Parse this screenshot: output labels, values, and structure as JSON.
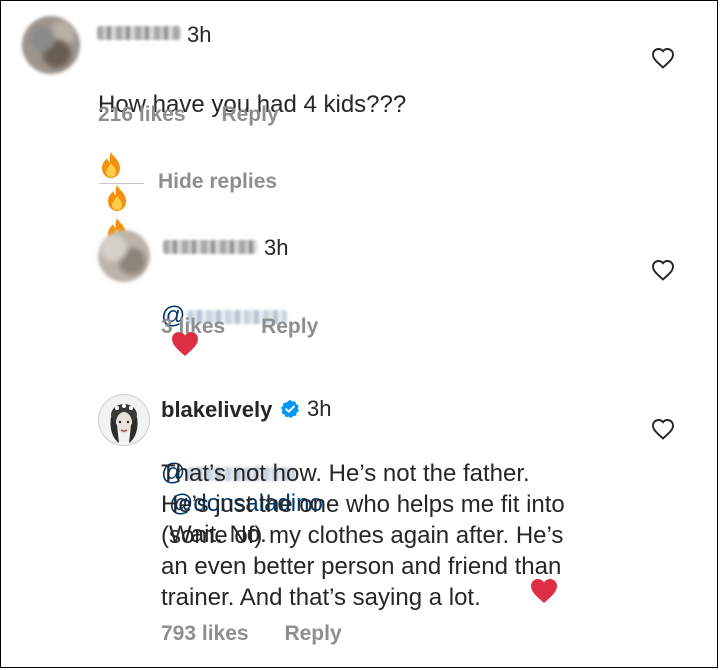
{
  "comment1": {
    "time": "3h",
    "text": "How have you had 4 kids???",
    "likes": "216 likes",
    "reply": "Reply"
  },
  "hide_replies": "Hide replies",
  "reply1": {
    "time": "3h",
    "at": "@",
    "likes": "3 likes",
    "reply": "Reply"
  },
  "reply2": {
    "username": "blakelively",
    "verified_color": "#0095f6",
    "time": "3h",
    "at": "@",
    "mention": "@donsaladino",
    "text_first": "Wait. No.",
    "text_rest": "That’s not how. He’s not the father.\nHe’s just the one who helps me fit into\n(some of) my clothes again after. He’s\nan even better person and friend than\ntrainer. And that’s saying a lot.",
    "likes": "793 likes",
    "reply": "Reply"
  },
  "icons": {
    "fire": "fire-emoji",
    "heart": "red-heart-emoji",
    "like": "heart-outline-icon",
    "verified": "verified-badge-icon"
  }
}
